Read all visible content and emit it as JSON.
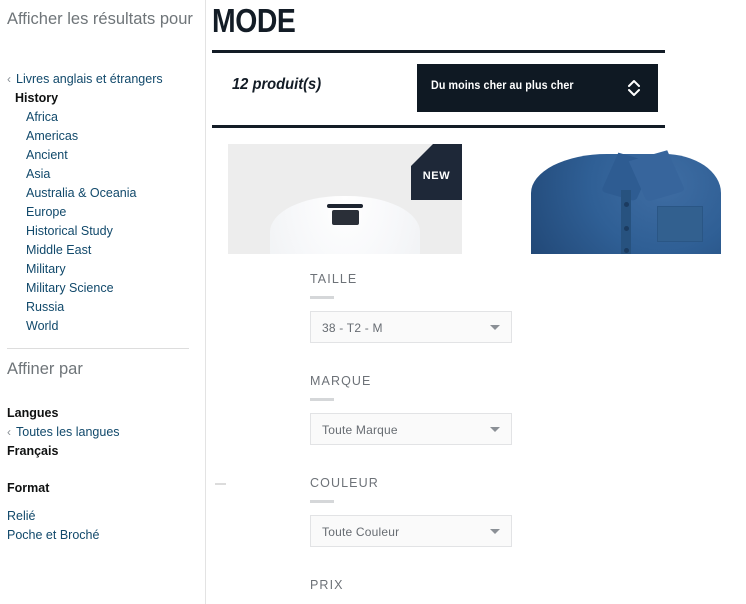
{
  "sidebar": {
    "title": "Afficher les résultats pour",
    "back_link": {
      "icon": "chevron-left-icon",
      "label": "Livres anglais et étrangers"
    },
    "current_category": "History",
    "categories": [
      "Africa",
      "Americas",
      "Ancient",
      "Asia",
      "Australia & Oceania",
      "Europe",
      "Historical Study",
      "Middle East",
      "Military",
      "Military Science",
      "Russia",
      "World"
    ],
    "refine_title": "Affiner par",
    "groups": [
      {
        "title": "Langues",
        "back_link": {
          "icon": "chevron-left-icon",
          "label": "Toutes les langues"
        },
        "selected": "Français"
      },
      {
        "title": "Format",
        "options": [
          "Relié",
          "Poche et Broché"
        ]
      }
    ]
  },
  "main": {
    "page_title": "MODE",
    "product_count": "12 produit(s)",
    "sort": {
      "selected": "Du moins cher au plus cher",
      "icon": "sort-chevron-updown-icon"
    },
    "products": [
      {
        "badge": "NEW",
        "image": "white-dress-shirt"
      },
      {
        "badge": "",
        "image": "blue-denim-shirt"
      }
    ],
    "filters": [
      {
        "label": "TAILLE",
        "value": "38 - T2 - M",
        "icon": "chevron-down-icon"
      },
      {
        "label": "MARQUE",
        "value": "Toute Marque",
        "icon": "chevron-down-icon"
      },
      {
        "label": "COULEUR",
        "value": "Toute Couleur",
        "icon": "chevron-down-icon"
      },
      {
        "label": "PRIX",
        "value": "",
        "icon": "chevron-down-icon"
      }
    ]
  },
  "colors": {
    "dark_navy": "#0f1923",
    "badge_navy": "#1e2838",
    "link_blue": "#11496b",
    "muted_gray": "#6f7579"
  }
}
